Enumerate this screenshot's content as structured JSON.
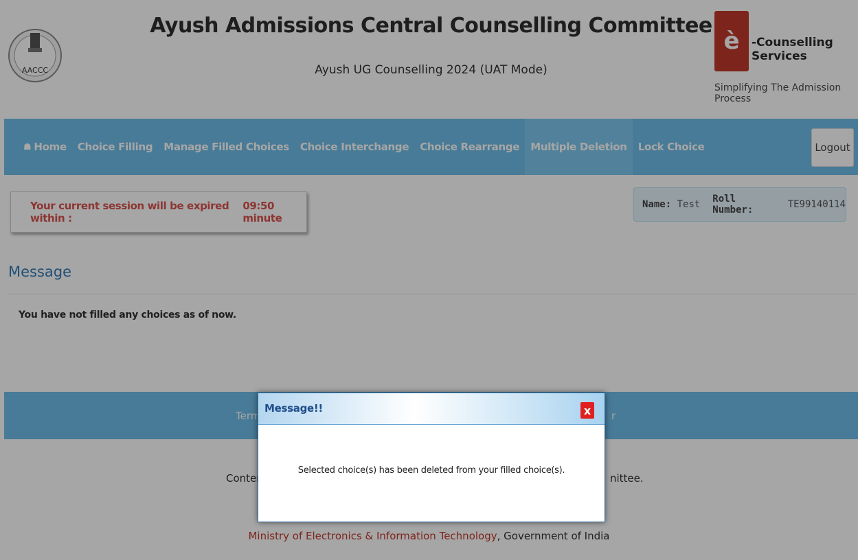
{
  "header": {
    "title": "Ayush Admissions Central Counselling Committee",
    "subtitle": "Ayush UG Counselling 2024 (UAT Mode)",
    "emblem_label": "AACCC",
    "ecs_logo_glyph": "è",
    "ecs_name": "-Counselling Services",
    "ecs_tagline": "Simplifying The Admission Process"
  },
  "nav": {
    "items": [
      {
        "label": "Home",
        "icon": "home-icon",
        "glyph": "☗"
      },
      {
        "label": "Choice Filling"
      },
      {
        "label": "Manage Filled Choices"
      },
      {
        "label": "Choice Interchange"
      },
      {
        "label": "Choice Rearrange"
      },
      {
        "label": "Multiple Deletion",
        "active": true
      },
      {
        "label": "Lock Choice"
      }
    ],
    "logout_label": "Logout"
  },
  "session": {
    "text": "Your current session will be expired within :",
    "time": "09:50 minute"
  },
  "user": {
    "name_label": "Name:",
    "name_value": "Test",
    "roll_label": "Roll Number:",
    "roll_value": "TE99140114"
  },
  "message_section": {
    "heading": "Message",
    "body": "You have not filled any choices as of now."
  },
  "footer": {
    "bar_left": "Term",
    "bar_right": "r",
    "content_left": "Conten",
    "content_right": "nittee.",
    "ministry_link": "Ministry of Electronics & Information Technology",
    "ministry_suffix": ", Government of India"
  },
  "dialog": {
    "title": "Message!!",
    "close_glyph": "x",
    "body": "Selected choice(s) has been deleted from your filled choice(s)."
  },
  "colors": {
    "nav_bg": "#6fbde8",
    "overlay": "rgba(0,0,0,0.35)",
    "session_text": "#d9534f",
    "heading_blue": "#337ab7",
    "close_red": "#e02020"
  }
}
